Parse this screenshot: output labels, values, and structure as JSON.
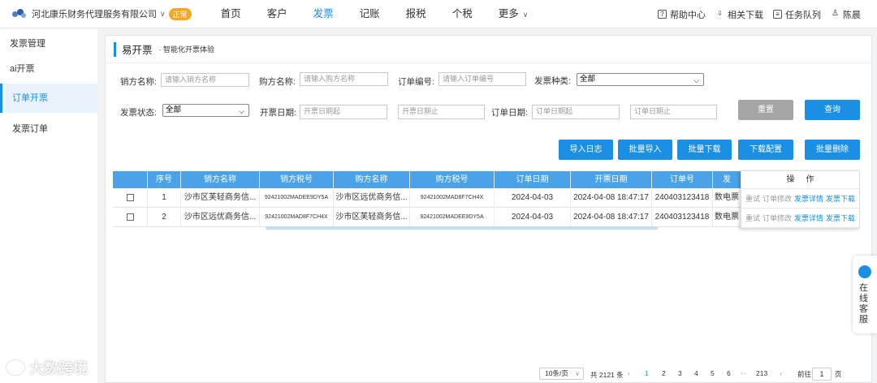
{
  "topbar": {
    "company": "河北康乐财务代理服务有限公司",
    "badge": "正常",
    "nav": [
      "首页",
      "客户",
      "发票",
      "记账",
      "报税",
      "个税",
      "更多"
    ],
    "tools": [
      "帮助中心",
      "相关下载",
      "任务队列",
      "陈晨"
    ]
  },
  "sidebar": {
    "items": [
      "发票管理",
      "ai开票",
      "订单开票",
      "发票订单"
    ]
  },
  "card": {
    "title": "易开票",
    "subtitle": "· 智能化开票体验"
  },
  "filters": {
    "seller_label": "销方名称:",
    "seller_placeholder": "请输入销方名称",
    "buyer_label": "购方名称:",
    "buyer_placeholder": "请输入购方名称",
    "order_label": "订单编号:",
    "order_placeholder": "请输入订单编号",
    "type_label": "发票种类:",
    "type_value": "全部",
    "status_label": "发票状态:",
    "status_value": "全部",
    "issue_label": "开票日期:",
    "issue_start": "开票日期起",
    "issue_end": "开票日期止",
    "orderdate_label": "订单日期:",
    "orderdate_start": "订单日期起",
    "orderdate_end": "订单日期止"
  },
  "buttons": {
    "reset": "重置",
    "query": "查询",
    "import_log": "导入日志",
    "batch_import": "批量导入",
    "batch_download": "批量下载",
    "download_config": "下载配置",
    "batch_delete": "批量删除"
  },
  "table": {
    "headers": [
      "",
      "序号",
      "销方名称",
      "销方税号",
      "购方名称",
      "购方税号",
      "订单日期",
      "开票日期",
      "订单号",
      "发"
    ],
    "rows": [
      {
        "no": "1",
        "seller": "沙市区芙轻商务信...",
        "seller_tax": "92421002MADEE9DY5A",
        "buyer": "沙市区远优商务信...",
        "buyer_tax": "92421002MAD8F7CH4X",
        "order_date": "2024-04-03",
        "issue_date": "2024-04-08 18:47:17",
        "order_no": "240403123418",
        "type": "数电票"
      },
      {
        "no": "2",
        "seller": "沙市区远优商务信...",
        "seller_tax": "92421002MAD8F7CH4X",
        "buyer": "沙市区芙轻商务信...",
        "buyer_tax": "92421002MADEE9DY5A",
        "order_date": "2024-04-03",
        "issue_date": "2024-04-08 18:47:17",
        "order_no": "240403123418",
        "type": "数电票"
      }
    ],
    "op_header": "操作",
    "ops": [
      "重试",
      "订单修改",
      "发票详情",
      "发票下载"
    ]
  },
  "pagination": {
    "page_size": "10条/页",
    "total": "共 2121 条",
    "pages": [
      "1",
      "2",
      "3",
      "4",
      "5",
      "6",
      "···",
      "213"
    ],
    "goto_label": "前往",
    "goto_value": "1",
    "page_unit": "页"
  },
  "service": {
    "text": "在线客服"
  },
  "watermark": "大数跨境",
  "colors": {
    "primary": "#1a8fe3",
    "header_blue": "#4aa3e8",
    "badge": "#f5a623"
  }
}
